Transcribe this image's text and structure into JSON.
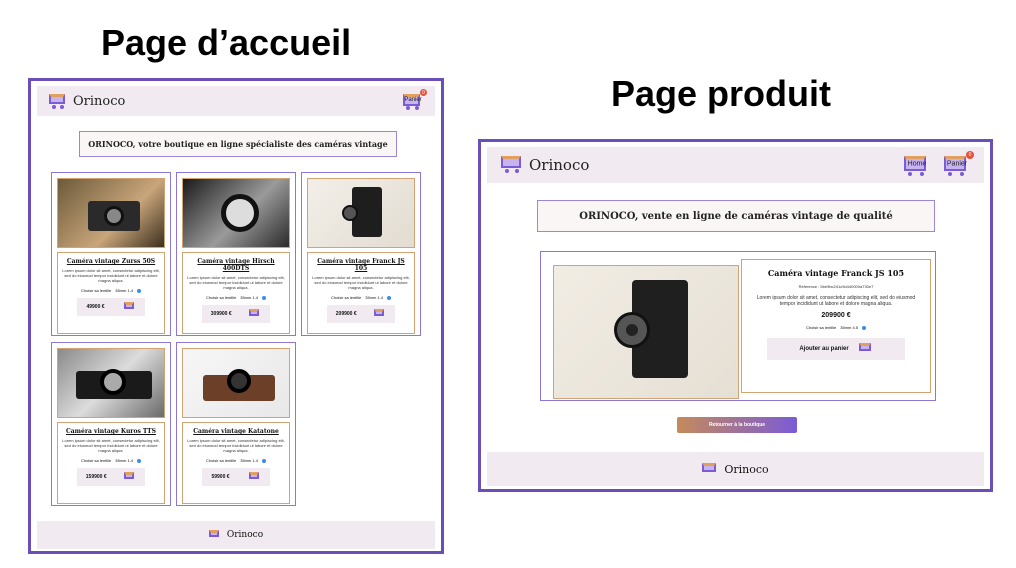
{
  "left_title": "Page d’accueil",
  "right_title": "Page produit",
  "home": {
    "brand": "Orinoco",
    "cart_label": "Panier",
    "cart_count": "0",
    "tagline": "ORINOCO, votre boutique en ligne spécialiste des caméras vintage",
    "lens_label": "Choisir sa lentille",
    "lens_value": "35mm 1.4",
    "lorem": "Lorem ipsum dolor sit amet, consectetur adipiscing elit, sed do eiusmod tempor incididunt ut labore et dolore magna aliqua.",
    "products": [
      {
        "name": "Caméra vintage Zurss 50S",
        "price": "49900 €"
      },
      {
        "name": "Caméra vintage Hirsch 400DTS",
        "price": "309900 €"
      },
      {
        "name": "Caméra vintage Franck JS 105",
        "price": "209900 €"
      },
      {
        "name": "Caméra vintage Kuros TTS",
        "price": "159900 €"
      },
      {
        "name": "Caméra vintage Katatone",
        "price": "59900 €"
      }
    ],
    "footer_brand": "Orinoco"
  },
  "product": {
    "brand": "Orinoco",
    "home_label": "Home",
    "cart_label": "Panier",
    "cart_count": "0",
    "tagline": "ORINOCO, vente en ligne de caméras vintage de qualité",
    "name": "Caméra vintage Franck JS 105",
    "reference": "Référence : 5be9bc241c9d440000a730e7",
    "description": "Lorem ipsum dolor sit amet, consectetur adipiscing elit, sed do eiusmod tempor incididunt ut labore et dolore magna aliqua.",
    "price": "209900 €",
    "lens_label": "Choisir sa lentille",
    "lens_value": "35mm 4.5",
    "add_label": "Ajouter au panier",
    "back_label": "Retourner à la boutique",
    "footer_brand": "Orinoco"
  },
  "colors": {
    "frame": "#6a4fb8",
    "header_bg": "#f1ebf1",
    "card_border": "#d4a373",
    "accent_gradient": [
      "#c58a5a",
      "#7b5bd6"
    ]
  }
}
